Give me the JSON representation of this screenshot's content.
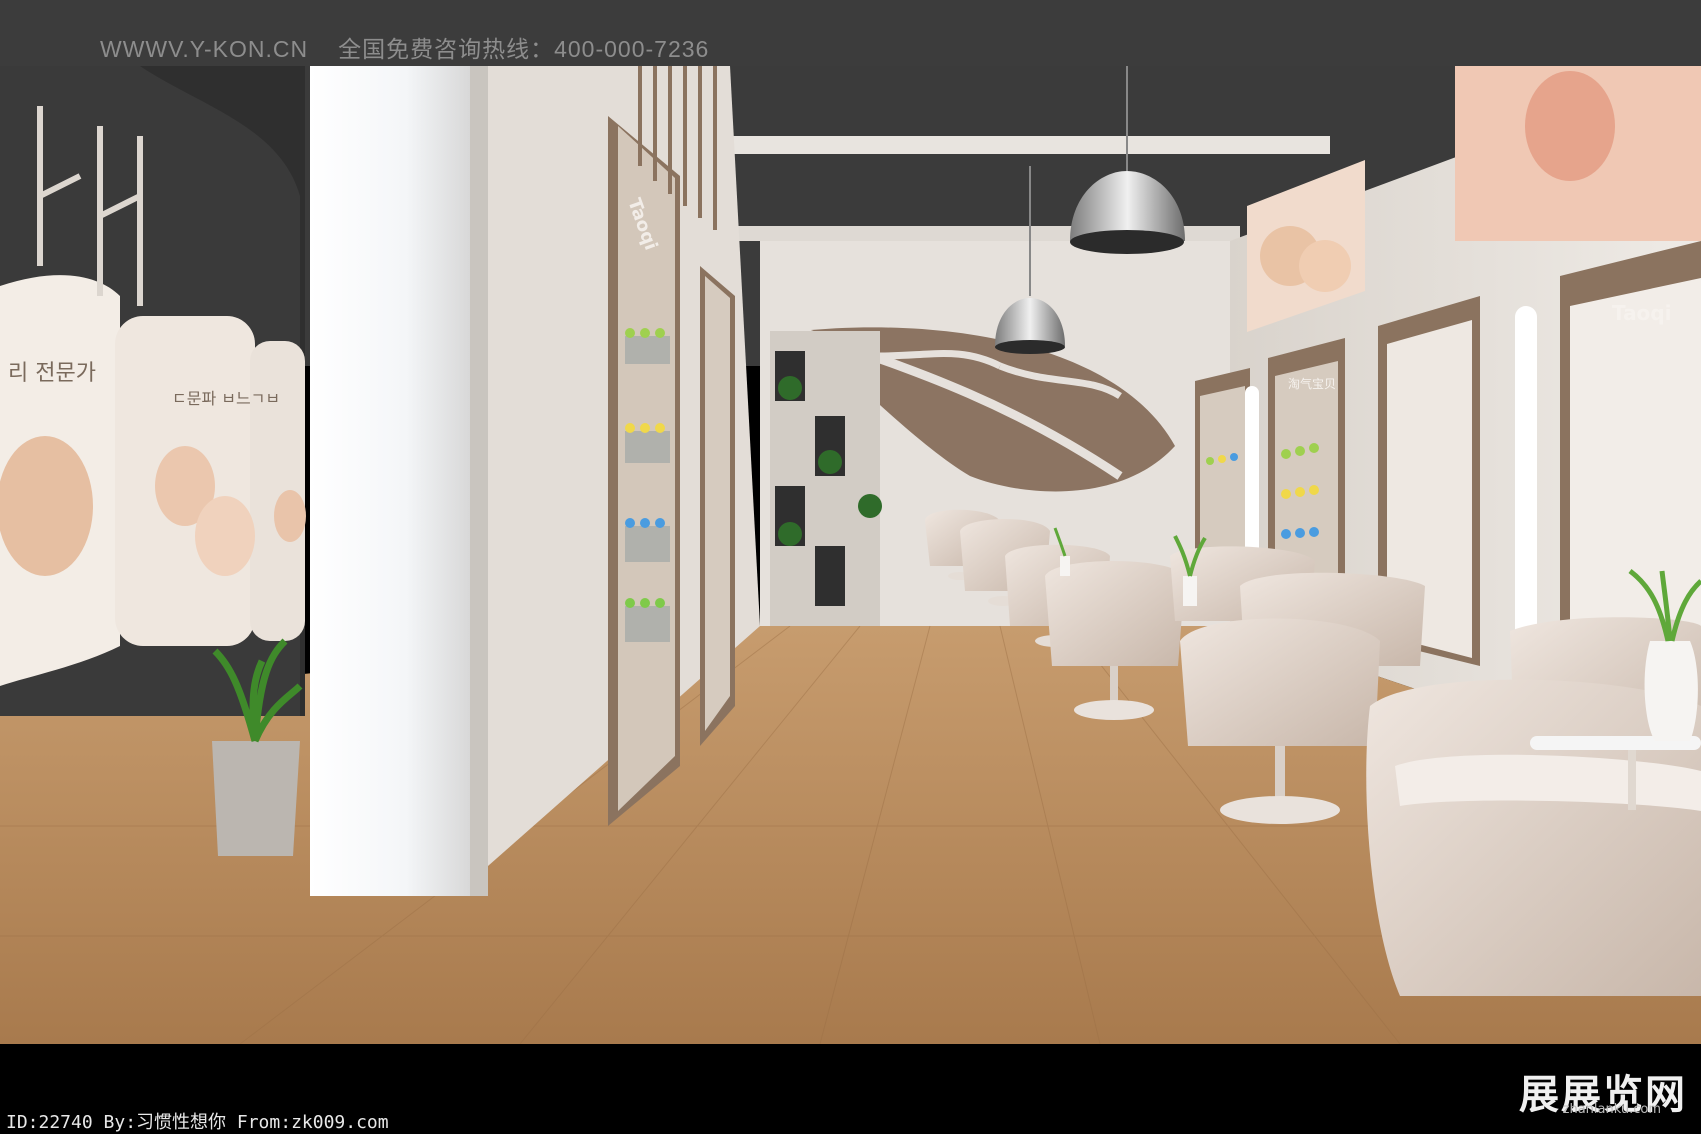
{
  "header": {
    "website": "WWWV.Y-KON.CN",
    "hotline": "全国免费咨询热线：400-000-7236"
  },
  "footer": {
    "credit": "ID:22740 By:习惯性想你 From:zk009.com",
    "watermark_logo": "展展览网",
    "watermark_domain": "zhanlanku.com"
  },
  "scene": {
    "brand_text": "Taoqi",
    "brand_text_cn": "淘气宝贝",
    "left_wall_text_1": "리 전문가",
    "left_wall_text_2": "ㄷ문파 ㅂ느ㄱㅂ"
  },
  "colors": {
    "wall": "#e9e4de",
    "ceiling": "#3b3b3b",
    "floor": "#b58a5c",
    "wood_panel": "#8a7361",
    "chair": "#e3d6cc"
  }
}
